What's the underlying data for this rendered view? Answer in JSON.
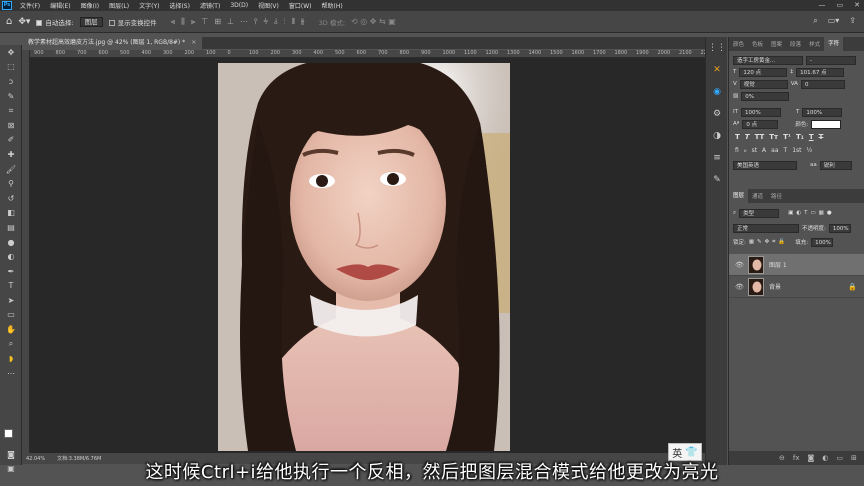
{
  "app": {
    "logo": "Ps"
  },
  "menubar": {
    "items": [
      "文件(F)",
      "编辑(E)",
      "图像(I)",
      "图层(L)",
      "文字(Y)",
      "选择(S)",
      "滤镜(T)",
      "3D(D)",
      "视图(V)",
      "窗口(W)",
      "帮助(H)"
    ]
  },
  "optbar": {
    "auto_select_label": "自动选择:",
    "auto_select_value": "图层",
    "show_transform_label": "显示变换控件",
    "mode_3d_label": "3D 模式:"
  },
  "document": {
    "tab_title": "教学素材超高效磨皮方法.jpg @ 42% (图层 1, RGB/8#) *",
    "zoom": "42.04%",
    "status_text": "文档:3.38M/6.76M"
  },
  "ruler": {
    "h_labels": [
      "900",
      "800",
      "700",
      "600",
      "500",
      "400",
      "300",
      "200",
      "100",
      "0",
      "100",
      "200",
      "300",
      "400",
      "500",
      "600",
      "700",
      "800",
      "900",
      "1000",
      "1100",
      "1200",
      "1300",
      "1400",
      "1500",
      "1600",
      "1700",
      "1800",
      "1900",
      "2000",
      "2100",
      "2200"
    ]
  },
  "panels": {
    "top_tabs": [
      "颜色",
      "色板",
      "图案",
      "段落",
      "样式",
      "字符"
    ],
    "character": {
      "font_family": "造字工房黄金...",
      "font_style": "-",
      "font_size": "120 点",
      "leading": "101.67 点",
      "kerning": "视觉",
      "tracking": "0",
      "scale_pct": "0%",
      "v_scale": "100%",
      "h_scale": "100%",
      "baseline": "0 点",
      "color_label": "颜色:",
      "language": "美国英语",
      "antialias": "锐利"
    },
    "layers": {
      "tabs": [
        "图层",
        "通道",
        "路径"
      ],
      "filter_kind": "类型",
      "blend_mode": "正常",
      "opacity_label": "不透明度:",
      "opacity_value": "100%",
      "lock_label": "锁定:",
      "fill_label": "填充:",
      "fill_value": "100%",
      "items": [
        {
          "name": "图层 1",
          "active": true
        },
        {
          "name": "背景",
          "active": false
        }
      ]
    }
  },
  "subtitle": "这时候Ctrl+i给他执行一个反相，然后把图层混合模式给他更改为亮光",
  "ime": {
    "label": "英"
  }
}
